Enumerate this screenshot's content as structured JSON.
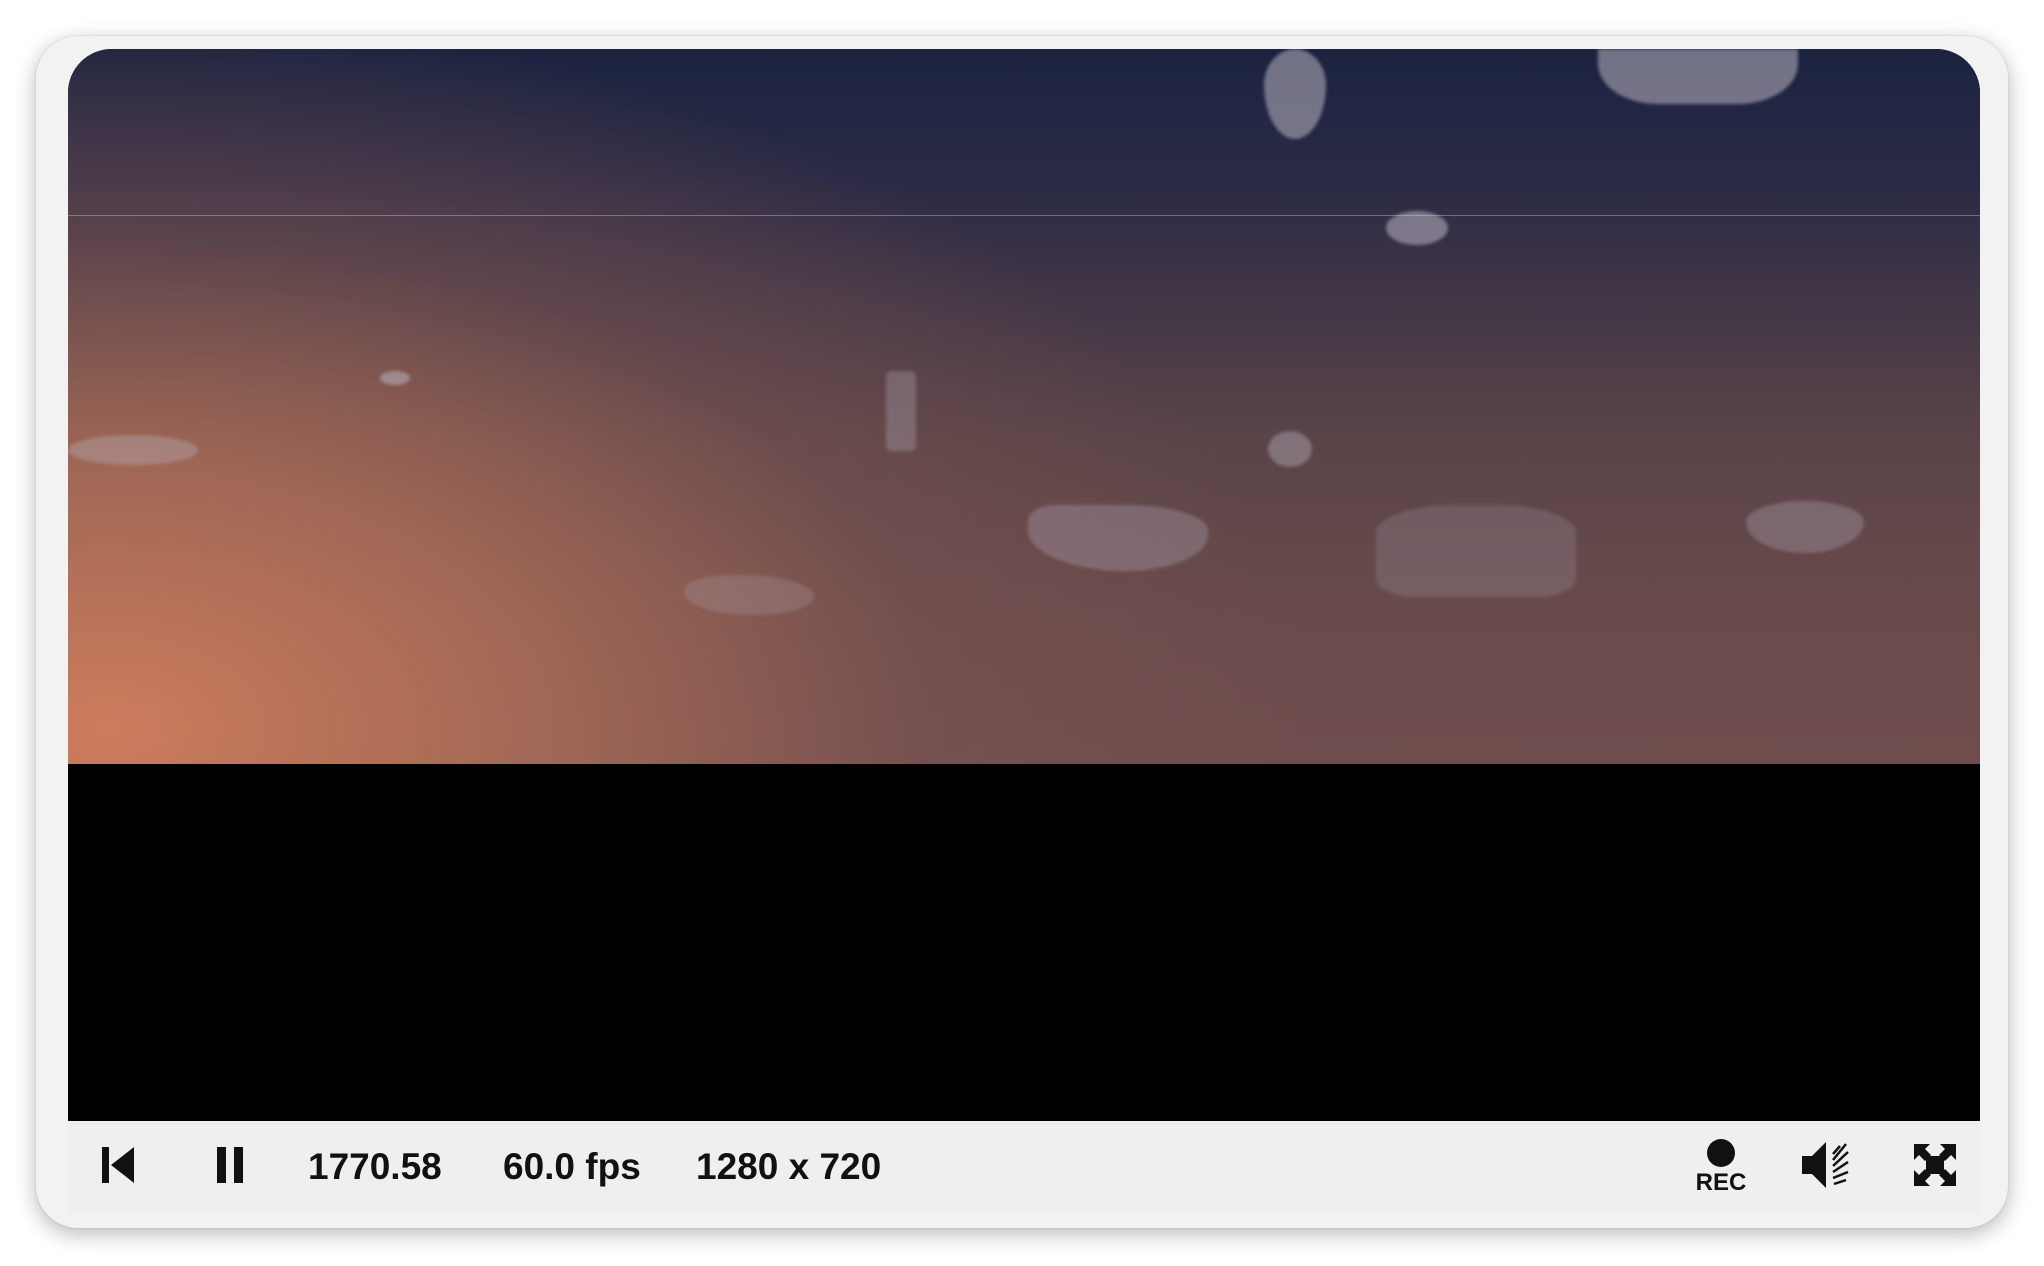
{
  "player": {
    "time": "1770.58",
    "fps": "60.0 fps",
    "resolution": "1280 x 720",
    "rec_label": "REC"
  },
  "icons": {
    "restart": "skip-to-start-icon",
    "pause": "pause-icon",
    "record": "record-icon",
    "volume": "volume-icon",
    "fullscreen": "fullscreen-icon"
  },
  "colors": {
    "scene_glow": "#cd7c5c",
    "scene_sky": "#1b2340",
    "controls_bg": "#efefef",
    "text": "#111111"
  }
}
